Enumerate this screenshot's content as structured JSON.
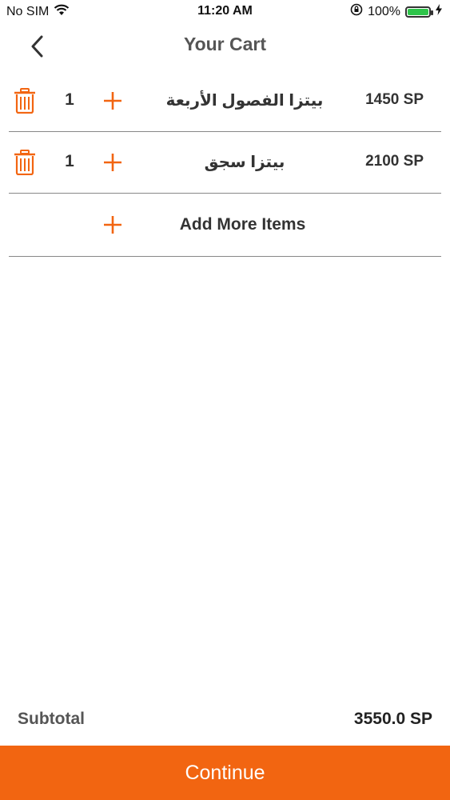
{
  "status_bar": {
    "carrier": "No SIM",
    "time": "11:20 AM",
    "battery_percent": "100%",
    "battery_level": 1.0,
    "icons": [
      "wifi-icon",
      "orientation-lock-icon",
      "battery-icon",
      "charging-icon"
    ]
  },
  "nav": {
    "title": "Your Cart",
    "back_icon": "chevron-left-icon"
  },
  "cart": {
    "items": [
      {
        "name": "بيتزا الفصول الأربعة",
        "quantity": "1",
        "price": "1450 SP"
      },
      {
        "name": "بيتزا سجق",
        "quantity": "1",
        "price": "2100 SP"
      }
    ],
    "add_more_label": "Add More Items"
  },
  "summary": {
    "subtotal_label": "Subtotal",
    "subtotal_value": "3550.0 SP"
  },
  "actions": {
    "continue_label": "Continue"
  },
  "colors": {
    "accent": "#f26511",
    "text": "#333333",
    "divider": "#888888",
    "battery": "#2ec44a"
  }
}
